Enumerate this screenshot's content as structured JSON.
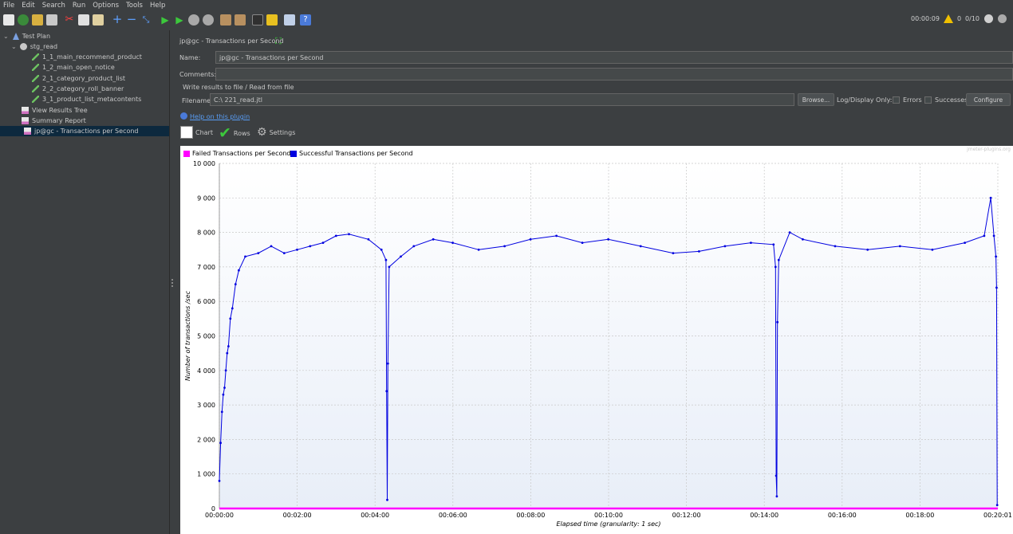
{
  "menu": [
    "File",
    "Edit",
    "Search",
    "Run",
    "Options",
    "Tools",
    "Help"
  ],
  "status": {
    "timer": "00:00:09",
    "warnings": "0",
    "threads": "0/10"
  },
  "tree": {
    "items": [
      {
        "label": "Test Plan",
        "icon": "test-plan-icon",
        "level": 0
      },
      {
        "label": "stg_read",
        "icon": "thread-group-gear-icon",
        "level": 1
      },
      {
        "label": "1_1_main_recommend_product",
        "icon": "sampler-pencil-icon",
        "level": 2
      },
      {
        "label": "1_2_main_open_notice",
        "icon": "sampler-pencil-icon",
        "level": 2
      },
      {
        "label": "2_1_category_product_list",
        "icon": "sampler-pencil-icon",
        "level": 2
      },
      {
        "label": "2_2_category_roll_banner",
        "icon": "sampler-pencil-icon",
        "level": 2
      },
      {
        "label": "3_1_product_list_metacontents",
        "icon": "sampler-pencil-icon",
        "level": 2
      },
      {
        "label": "View Results Tree",
        "icon": "listener-chart-icon",
        "level": 1
      },
      {
        "label": "Summary Report",
        "icon": "listener-chart-icon",
        "level": 1
      },
      {
        "label": "jp@gc - Transactions per Second",
        "icon": "listener-chart-icon",
        "level": 1,
        "selected": true
      }
    ]
  },
  "panel": {
    "title": "jp@gc - Transactions per Second",
    "name_label": "Name:",
    "name_value": "jp@gc - Transactions per Second",
    "comments_label": "Comments:",
    "comments_value": "",
    "file_section": "Write results to file / Read from file",
    "filename_label": "Filename",
    "filename_value": "C:\\                                                                                              221_read.jtl",
    "browse": "Browse...",
    "log_display": "Log/Display Only:",
    "errors": "Errors",
    "successes": "Successes",
    "configure": "Configure",
    "help_link": "Help on this plugin",
    "tabs": [
      "Chart",
      "Rows",
      "Settings"
    ]
  },
  "chart_data": {
    "type": "line",
    "watermark": "jmeter-plugins.org",
    "xlabel": "Elapsed time (granularity: 1 sec)",
    "ylabel": "Number of transactions /sec",
    "ylim": [
      0,
      10000
    ],
    "yticks": [
      "0",
      "1 000",
      "2 000",
      "3 000",
      "4 000",
      "5 000",
      "6 000",
      "7 000",
      "8 000",
      "9 000",
      "10 000"
    ],
    "xticks": [
      "00:00:00",
      "00:02:00",
      "00:04:00",
      "00:06:00",
      "00:08:00",
      "00:10:00",
      "00:12:00",
      "00:14:00",
      "00:16:00",
      "00:18:00",
      "00:20:01"
    ],
    "xlim_seconds": [
      0,
      1201
    ],
    "grid": true,
    "legend_position": "top-left",
    "series": [
      {
        "name": "Failed Transactions per Second",
        "color": "#ff00ff",
        "points": [
          [
            0,
            0
          ],
          [
            1201,
            0
          ]
        ]
      },
      {
        "name": "Successful Transactions per Second",
        "color": "#0000e0",
        "points": [
          [
            0,
            800
          ],
          [
            2,
            1900
          ],
          [
            4,
            2800
          ],
          [
            6,
            3300
          ],
          [
            8,
            3500
          ],
          [
            10,
            4000
          ],
          [
            12,
            4500
          ],
          [
            14,
            4700
          ],
          [
            17,
            5500
          ],
          [
            20,
            5800
          ],
          [
            25,
            6500
          ],
          [
            30,
            6900
          ],
          [
            40,
            7300
          ],
          [
            60,
            7400
          ],
          [
            80,
            7600
          ],
          [
            100,
            7400
          ],
          [
            120,
            7500
          ],
          [
            140,
            7600
          ],
          [
            160,
            7700
          ],
          [
            180,
            7900
          ],
          [
            200,
            7950
          ],
          [
            230,
            7800
          ],
          [
            250,
            7500
          ],
          [
            257,
            7200
          ],
          [
            258,
            3400
          ],
          [
            259,
            250
          ],
          [
            260,
            4200
          ],
          [
            262,
            7000
          ],
          [
            280,
            7300
          ],
          [
            300,
            7600
          ],
          [
            330,
            7800
          ],
          [
            360,
            7700
          ],
          [
            400,
            7500
          ],
          [
            440,
            7600
          ],
          [
            480,
            7800
          ],
          [
            520,
            7900
          ],
          [
            560,
            7700
          ],
          [
            600,
            7800
          ],
          [
            650,
            7600
          ],
          [
            700,
            7400
          ],
          [
            740,
            7450
          ],
          [
            780,
            7600
          ],
          [
            820,
            7700
          ],
          [
            855,
            7650
          ],
          [
            858,
            7000
          ],
          [
            859,
            950
          ],
          [
            860,
            350
          ],
          [
            861,
            5400
          ],
          [
            863,
            7200
          ],
          [
            880,
            8000
          ],
          [
            900,
            7800
          ],
          [
            950,
            7600
          ],
          [
            1000,
            7500
          ],
          [
            1050,
            7600
          ],
          [
            1100,
            7500
          ],
          [
            1150,
            7700
          ],
          [
            1180,
            7900
          ],
          [
            1190,
            9000
          ],
          [
            1195,
            7900
          ],
          [
            1198,
            7300
          ],
          [
            1199,
            6400
          ],
          [
            1200,
            100
          ]
        ]
      }
    ]
  }
}
